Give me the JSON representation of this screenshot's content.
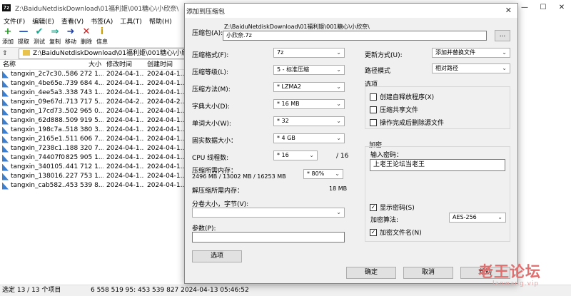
{
  "fm": {
    "title": "Z:\\BaiduNetdiskDownload\\01福利姬\\001糖心\\小欣奈\\",
    "app_icon": "7z",
    "win_buttons": [
      "—",
      "☐",
      "✕"
    ],
    "menu": [
      "文件(F)",
      "编辑(E)",
      "查看(V)",
      "书签(A)",
      "工具(T)",
      "帮助(H)"
    ],
    "toolbar": [
      {
        "icon": "+",
        "label": "添加",
        "color": "#1a9a1a"
      },
      {
        "icon": "—",
        "label": "提取",
        "color": "#1e4fbf"
      },
      {
        "icon": "✔",
        "label": "测试",
        "color": "#1aa38a"
      },
      {
        "icon": "⇒",
        "label": "复制",
        "color": "#1aa38a"
      },
      {
        "icon": "➜",
        "label": "移动",
        "color": "#1e3fae"
      },
      {
        "icon": "✕",
        "label": "删除",
        "color": "#d01818"
      },
      {
        "icon": "i",
        "label": "信息",
        "color": "#c9a100"
      }
    ],
    "path": "Z:\\BaiduNetdiskDownload\\01福利姬\\001糖心\\小欣奈\\",
    "columns": [
      "名称",
      "大小",
      "修改时间",
      "创建时间"
    ],
    "rows": [
      {
        "name": "tangxin_2c7c30...",
        "size": "586 272 1...",
        "mtime": "2024-04-1...",
        "ctime": "2024-04-1..."
      },
      {
        "name": "tangxin_4be65e...",
        "size": "739 684 4...",
        "mtime": "2024-04-1...",
        "ctime": "2024-04-1..."
      },
      {
        "name": "tangxin_4ee5a3...",
        "size": "338 743 1...",
        "mtime": "2024-04-1...",
        "ctime": "2024-04-1..."
      },
      {
        "name": "tangxin_09e67d...",
        "size": "713 717 5...",
        "mtime": "2024-04-2...",
        "ctime": "2024-04-2..."
      },
      {
        "name": "tangxin_17cd73...",
        "size": "502 965 0...",
        "mtime": "2024-04-1...",
        "ctime": "2024-04-1..."
      },
      {
        "name": "tangxin_62d888...",
        "size": "509 919 5...",
        "mtime": "2024-04-1...",
        "ctime": "2024-04-1..."
      },
      {
        "name": "tangxin_198c7a...",
        "size": "518 380 3...",
        "mtime": "2024-04-1...",
        "ctime": "2024-04-1..."
      },
      {
        "name": "tangxin_2165e1...",
        "size": "511 606 7...",
        "mtime": "2024-04-1...",
        "ctime": "2024-04-1..."
      },
      {
        "name": "tangxin_7238c1...",
        "size": "188 320 7...",
        "mtime": "2024-04-1...",
        "ctime": "2024-04-1..."
      },
      {
        "name": "tangxin_74407f0...",
        "size": "825 905 1...",
        "mtime": "2024-04-1...",
        "ctime": "2024-04-1..."
      },
      {
        "name": "tangxin_340105...",
        "size": "441 712 1...",
        "mtime": "2024-04-1...",
        "ctime": "2024-04-1..."
      },
      {
        "name": "tangxin_138016...",
        "size": "227 753 1...",
        "mtime": "2024-04-1...",
        "ctime": "2024-04-1..."
      },
      {
        "name": "tangxin_cab582...",
        "size": "453 539 8...",
        "mtime": "2024-04-1...",
        "ctime": "2024-04-1..."
      }
    ],
    "status_left": "选定 13 / 13 个项目",
    "status_right": "6 558 519 95: 453 539 827  2024-04-13 05:46:52"
  },
  "dialog": {
    "title": "添加到压缩包",
    "close": "✕",
    "archive_label": "压缩包(A):",
    "archive_dir": "Z:\\BaiduNetdiskDownload\\01福利姬\\001糖心\\小欣奈\\",
    "archive_name": "小欣奈.7z",
    "browse": "...",
    "format_label": "压缩格式(F):",
    "format": "7z",
    "level_label": "压缩等级(L):",
    "level": "5 - 标准压缩",
    "method_label": "压缩方法(M):",
    "method": "* LZMA2",
    "dict_label": "字典大小(D):",
    "dict": "* 16 MB",
    "word_label": "单词大小(W):",
    "word": "* 32",
    "solid_label": "固实数据大小：",
    "solid": "* 4 GB",
    "threads_label": "CPU 线程数:",
    "threads": "* 16",
    "threads_total": "/ 16",
    "mem_label": "压缩所需内存：",
    "mem_value": "2496 MB / 13002 MB / 16253 MB",
    "mem_percent": "* 80%",
    "decomp_label": "解压缩所需内存：",
    "decomp_value": "18 MB",
    "volume_label": "分卷大小，字节(V):",
    "volume_value": "",
    "params_label": "参数(P):",
    "params_value": "",
    "options_btn": "选项",
    "update_label": "更新方式(U):",
    "update": "添加并替换文件",
    "pathmode_label": "路径模式",
    "pathmode": "相对路径",
    "options_group": "选项",
    "opt_sfx": "创建自释放程序(X)",
    "opt_shared": "压缩共享文件",
    "opt_delete": "操作完成后删除源文件",
    "enc_group": "加密",
    "pw_label": "输入密码：",
    "pw_value": "上老王论坛当老王",
    "show_pw": "显示密码(S)",
    "enc_method_label": "加密算法:",
    "enc_method": "AES-256",
    "enc_names": "加密文件名(N)",
    "ok": "确定",
    "cancel": "取消",
    "help": "帮助"
  },
  "watermark": {
    "big": "老王论坛",
    "small": "laowang.vip"
  }
}
